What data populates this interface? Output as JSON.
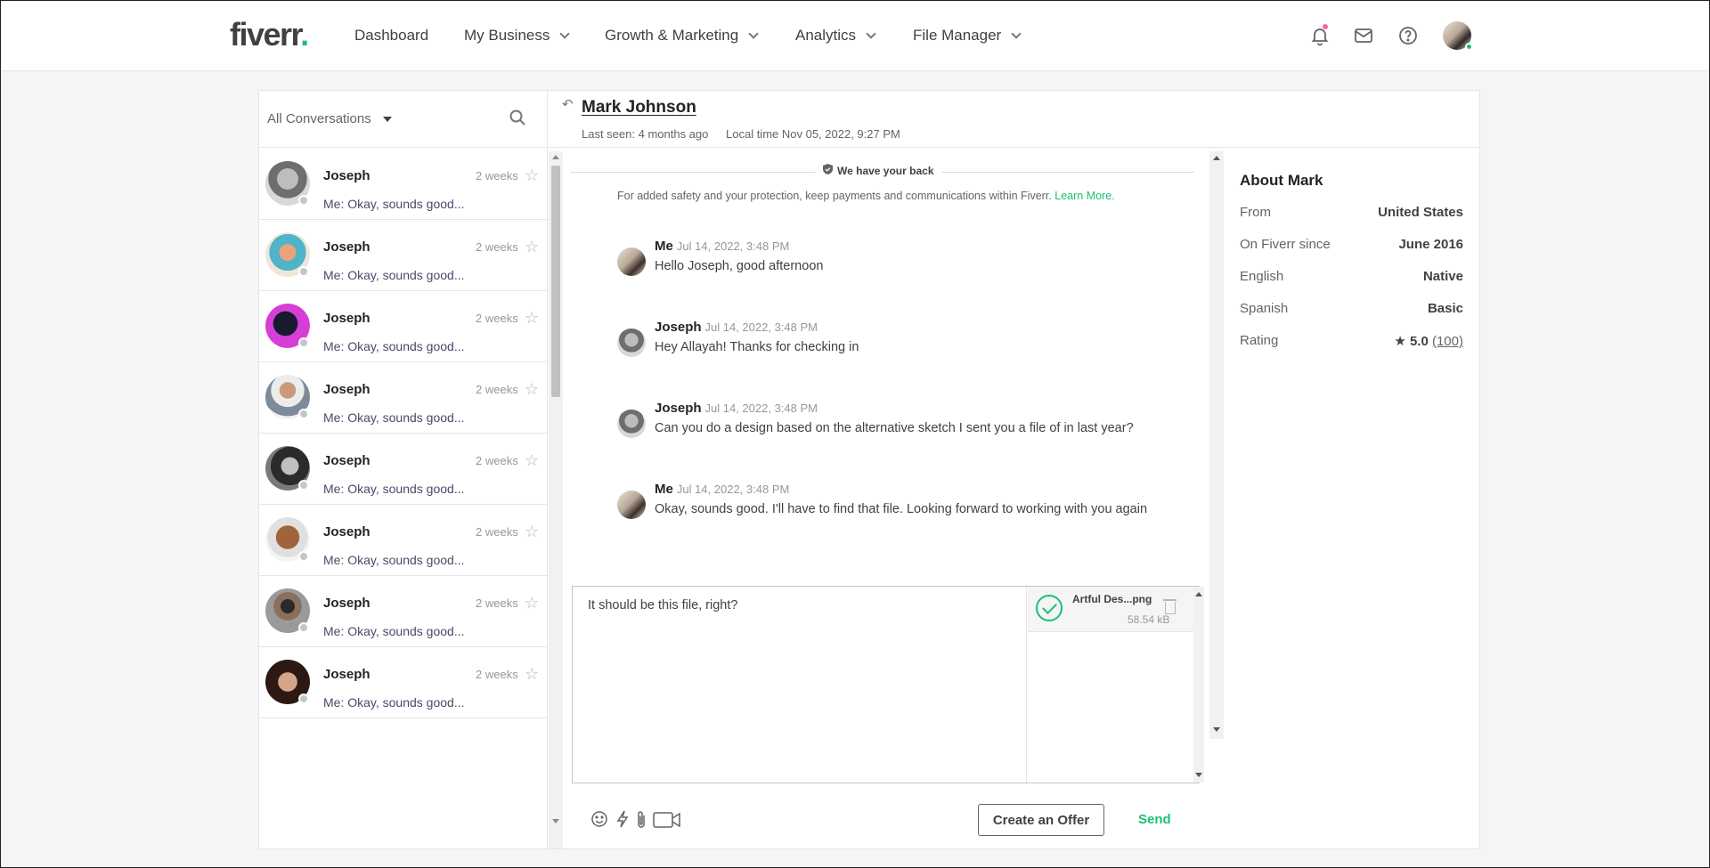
{
  "brand": {
    "logo_text": "fiverr",
    "logo_dot": ".",
    "accent": "#1dbf73"
  },
  "nav": {
    "items": [
      {
        "label": "Dashboard",
        "dropdown": false
      },
      {
        "label": "My Business",
        "dropdown": true
      },
      {
        "label": "Growth & Marketing",
        "dropdown": true
      },
      {
        "label": "Analytics",
        "dropdown": true
      },
      {
        "label": "File Manager",
        "dropdown": true
      }
    ],
    "icons": [
      "bell-icon",
      "envelope-icon",
      "help-icon"
    ],
    "notification_dot_color": "#ff62ad"
  },
  "inbox": {
    "filter_label": "All Conversations",
    "conversations": [
      {
        "name": "Joseph",
        "time": "2 weeks",
        "preview": "Me: Okay, sounds good..."
      },
      {
        "name": "Joseph",
        "time": "2 weeks",
        "preview": "Me: Okay, sounds good..."
      },
      {
        "name": "Joseph",
        "time": "2 weeks",
        "preview": "Me: Okay, sounds good..."
      },
      {
        "name": "Joseph",
        "time": "2 weeks",
        "preview": "Me: Okay, sounds good..."
      },
      {
        "name": "Joseph",
        "time": "2 weeks",
        "preview": "Me: Okay, sounds good..."
      },
      {
        "name": "Joseph",
        "time": "2 weeks",
        "preview": "Me: Okay, sounds good..."
      },
      {
        "name": "Joseph",
        "time": "2 weeks",
        "preview": "Me: Okay, sounds good..."
      },
      {
        "name": "Joseph",
        "time": "2 weeks",
        "preview": "Me: Okay, sounds good..."
      }
    ]
  },
  "conversation": {
    "contact_name": "Mark Johnson",
    "last_seen": "Last seen: 4 months ago",
    "local_time": "Local time Nov 05, 2022, 9:27 PM",
    "safety_badge": "We have your back",
    "safety_note": "For added safety and your protection, keep payments and communications within Fiverr.",
    "safety_link": "Learn More.",
    "messages": [
      {
        "sender": "Me",
        "time": "Jul 14, 2022, 3:48 PM",
        "text": "Hello Joseph, good afternoon"
      },
      {
        "sender": "Joseph",
        "time": "Jul 14, 2022, 3:48 PM",
        "text": "Hey Allayah! Thanks for checking in"
      },
      {
        "sender": "Joseph",
        "time": "Jul 14, 2022, 3:48 PM",
        "text": "Can you do a design based on the alternative sketch I sent you a file of in last year?"
      },
      {
        "sender": "Me",
        "time": "Jul 14, 2022, 3:48 PM",
        "text": "Okay, sounds good. I'll have to find that file. Looking forward to working with you again"
      }
    ]
  },
  "composer": {
    "draft": "It should be this file, right?",
    "attachment": {
      "name": "Artful Des...png",
      "size": "58.54 kB"
    },
    "create_offer_label": "Create an Offer",
    "send_label": "Send"
  },
  "about": {
    "title": "About Mark",
    "rows": [
      {
        "key": "From",
        "value": "United States"
      },
      {
        "key": "On Fiverr since",
        "value": "June 2016"
      },
      {
        "key": "English",
        "value": "Native"
      },
      {
        "key": "Spanish",
        "value": "Basic"
      }
    ],
    "rating_label": "Rating",
    "rating_value": "5.0",
    "rating_count": "(100)"
  }
}
